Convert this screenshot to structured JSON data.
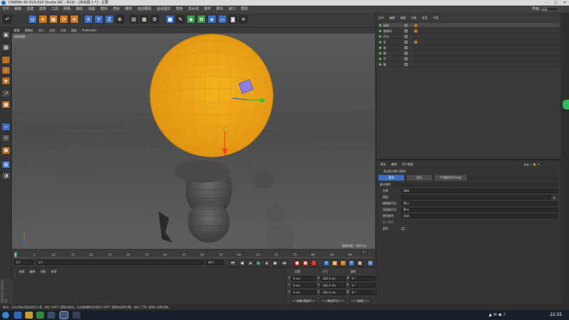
{
  "window": {
    "title": "CINEMA 4D R19.024 Studio (RC - R19) - [未标题 1 *] - 主要"
  },
  "menu": {
    "items": [
      "文件",
      "编辑",
      "创建",
      "选择",
      "工具",
      "网格",
      "捕捉",
      "动画",
      "模拟",
      "渲染",
      "雕刻",
      "运动跟踪",
      "运动图形",
      "角色",
      "流水线",
      "插件",
      "脚本",
      "窗口",
      "帮助"
    ],
    "layout_label": "界面",
    "layout_value": "启动"
  },
  "toolbar": {
    "icons": [
      "undo-icon",
      "select-icon",
      "move-icon",
      "scale-icon",
      "rotate-icon",
      "recent-icon",
      "x-axis-icon",
      "y-axis-icon",
      "z-axis-icon",
      "world-icon",
      "render-view-icon",
      "render-icon",
      "render-settings-icon",
      "cube-icon",
      "pen-icon",
      "subdivision-icon",
      "array-icon",
      "deformer-icon",
      "floor-icon",
      "camera-icon",
      "light-icon"
    ],
    "axis_labels": [
      "X",
      "Y",
      "Z"
    ]
  },
  "viewport": {
    "menu": [
      "查看",
      "摄像机",
      "显示",
      "选项",
      "过滤",
      "面板",
      "ProRender"
    ],
    "label": "透视视图",
    "grid_spacing": "网格间距 : 100 cm"
  },
  "timeline": {
    "ticks": [
      "0",
      "5",
      "10",
      "15",
      "20",
      "25",
      "30",
      "35",
      "40",
      "45",
      "50",
      "55",
      "60",
      "65",
      "70",
      "75",
      "80",
      "85",
      "90"
    ],
    "end_frame": "0 F"
  },
  "transport": {
    "start_field": "0 F",
    "current_field": "0 F",
    "max_field": "90 F",
    "end_field": "90 F"
  },
  "material_panel": {
    "tabs": [
      "创建",
      "编辑",
      "功能",
      "纹理"
    ]
  },
  "coordinates": {
    "headers": [
      "位置",
      "尺寸",
      "旋转"
    ],
    "position": [
      "0 cm",
      "0 cm",
      "0 cm"
    ],
    "size": [
      "185.4 cm",
      "185.4 cm",
      "185.4 cm"
    ],
    "rotation": [
      "0 °",
      "0 °",
      "0 °"
    ],
    "axes_pos": [
      "X",
      "Y",
      "Z"
    ],
    "axes_size": [
      "X",
      "Y",
      "Z"
    ],
    "axes_rot": [
      "H",
      "P",
      "B"
    ],
    "mode_button": "对象 (相对)",
    "size_button": "绝对尺寸",
    "apply_button": "应用"
  },
  "object_manager": {
    "menu": [
      "文件",
      "编辑",
      "查看",
      "对象",
      "标签",
      "书签"
    ],
    "objects": [
      {
        "name": "球体"
      },
      {
        "name": "摄像机"
      },
      {
        "name": "灯光"
      },
      {
        "name": "身"
      },
      {
        "name": "肩"
      },
      {
        "name": "臂"
      },
      {
        "name": "手"
      },
      {
        "name": "腿"
      }
    ]
  },
  "attributes": {
    "menu": [
      "模式",
      "编辑",
      "用户数据"
    ],
    "object_title": "多边形对象 [球体]",
    "tabs": [
      "基本",
      "坐标",
      "平滑着色(Phong)"
    ],
    "section": "基本属性",
    "props": [
      {
        "label": "名称",
        "value": "球体"
      },
      {
        "label": "图层",
        "value": ""
      },
      {
        "label": "编辑器可见",
        "value": "默认"
      },
      {
        "label": "渲染器可见",
        "value": "默认"
      },
      {
        "label": "使用颜色",
        "value": "关闭"
      },
      {
        "label": "显示颜色",
        "value": ""
      },
      {
        "label": "透显",
        "value": ""
      }
    ]
  },
  "status": {
    "text": "移动：点击并拖动鼠标移动元素。按住 SHIFT 键量化移动；节点编辑模式时按住 SHIFT 键增加选择对象；按住 CTRL 键减少选择对象。"
  },
  "taskbar": {
    "clock": "22:55"
  },
  "logo_text": "MAXON CINEMA 4D"
}
